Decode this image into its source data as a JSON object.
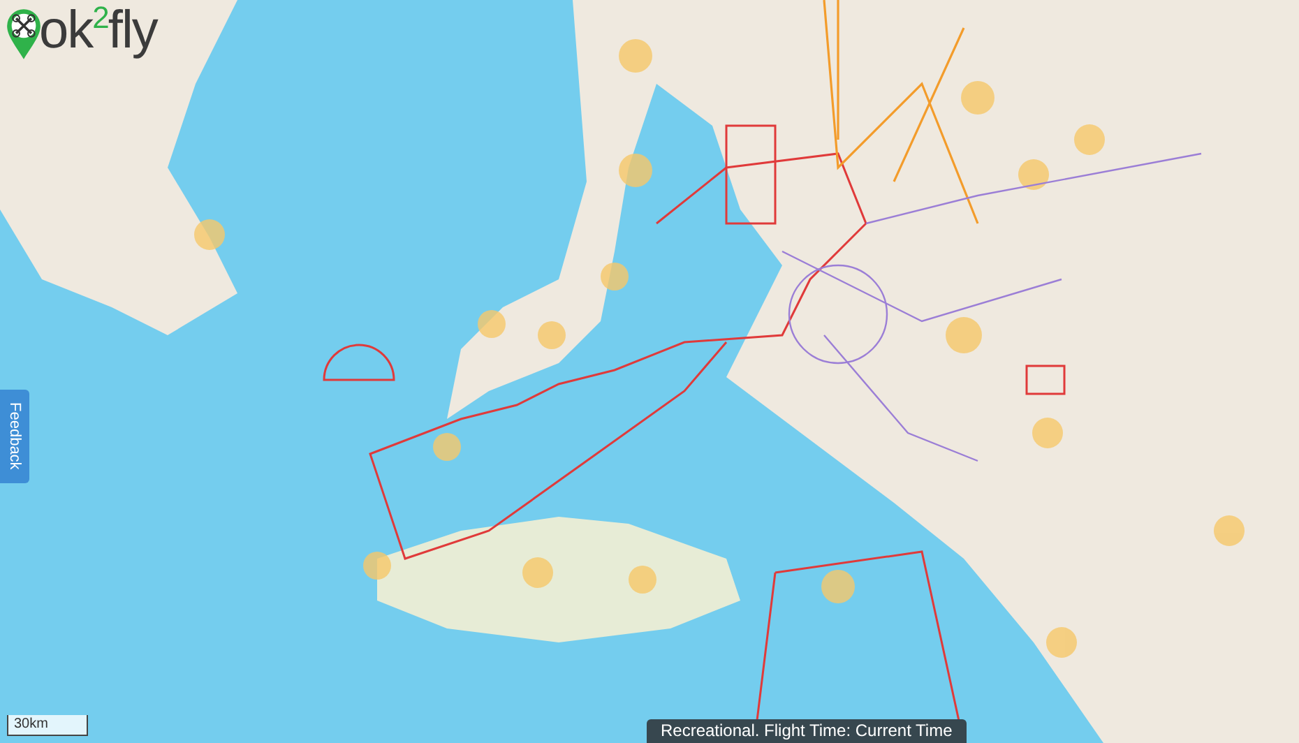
{
  "logo": {
    "text": "ok$^{2}$fly"
  },
  "feedback_tab": {
    "label": "Feedback"
  },
  "scale_bar": {
    "label": "30km"
  },
  "status_banner": {
    "text": "Recreational. Flight Time: Current Time"
  }
}
